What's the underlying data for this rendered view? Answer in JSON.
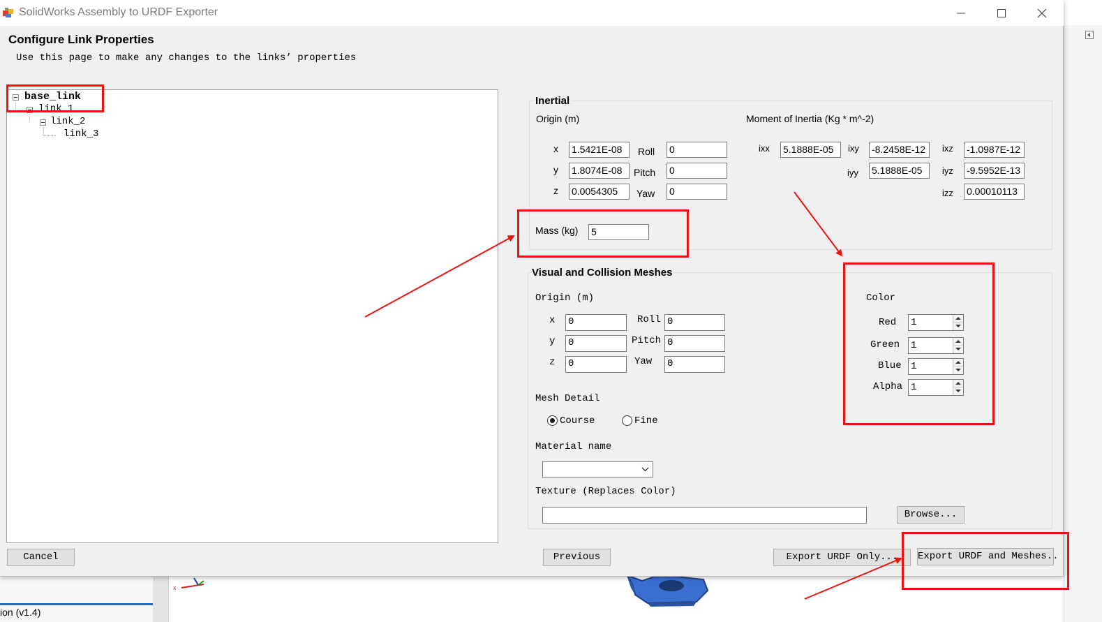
{
  "window": {
    "title": "SolidWorks Assembly to URDF Exporter"
  },
  "header": {
    "title": "Configure Link Properties",
    "subtitle": "Use this page to make any changes to the links’ properties"
  },
  "tree": {
    "items": [
      {
        "label": "base_link"
      },
      {
        "label": "link_1"
      },
      {
        "label": "link_2"
      },
      {
        "label": "link_3"
      }
    ]
  },
  "inertial": {
    "title": "Inertial",
    "origin_label": "Origin (m)",
    "moment_label": "Moment of Inertia (Kg * m^-2)",
    "x_label": "x",
    "y_label": "y",
    "z_label": "z",
    "x": "1.5421E-08",
    "y": "1.8074E-08",
    "z": "0.0054305",
    "roll_label": "Roll",
    "pitch_label": "Pitch",
    "yaw_label": "Yaw",
    "roll": "0",
    "pitch": "0",
    "yaw": "0",
    "ixx_label": "ixx",
    "ixy_label": "ixy",
    "ixz_label": "ixz",
    "iyy_label": "iyy",
    "iyz_label": "iyz",
    "izz_label": "izz",
    "ixx": "5.1888E-05",
    "ixy": "-8.2458E-12",
    "ixz": "-1.0987E-12",
    "iyy": "5.1888E-05",
    "iyz": "-9.5952E-13",
    "izz": "0.00010113",
    "mass_label": "Mass (kg)",
    "mass": "5"
  },
  "visual": {
    "title": "Visual and Collision Meshes",
    "origin_label": "Origin (m)",
    "x_label": "x",
    "y_label": "y",
    "z_label": "z",
    "x": "0",
    "y": "0",
    "z": "0",
    "roll_label": "Roll",
    "pitch_label": "Pitch",
    "yaw_label": "Yaw",
    "roll": "0",
    "pitch": "0",
    "yaw": "0",
    "color_label": "Color",
    "red_label": "Red",
    "green_label": "Green",
    "blue_label": "Blue",
    "alpha_label": "Alpha",
    "red": "1",
    "green": "1",
    "blue": "1",
    "alpha": "1",
    "mesh_detail_label": "Mesh Detail",
    "mesh_options": [
      {
        "label": "Course",
        "selected": true
      },
      {
        "label": "Fine",
        "selected": false
      }
    ],
    "material_label": "Material name",
    "material_value": "",
    "texture_label": "Texture (Replaces Color)",
    "texture_value": "",
    "browse_label": "Browse..."
  },
  "buttons": {
    "cancel": "Cancel",
    "previous": "Previous",
    "export_urdf_only": "Export URDF Only...",
    "export_urdf_meshes": "Export URDF and Meshes.."
  },
  "background": {
    "version_text": "ion (v1.4)"
  },
  "annotation_color": "#ee1111"
}
